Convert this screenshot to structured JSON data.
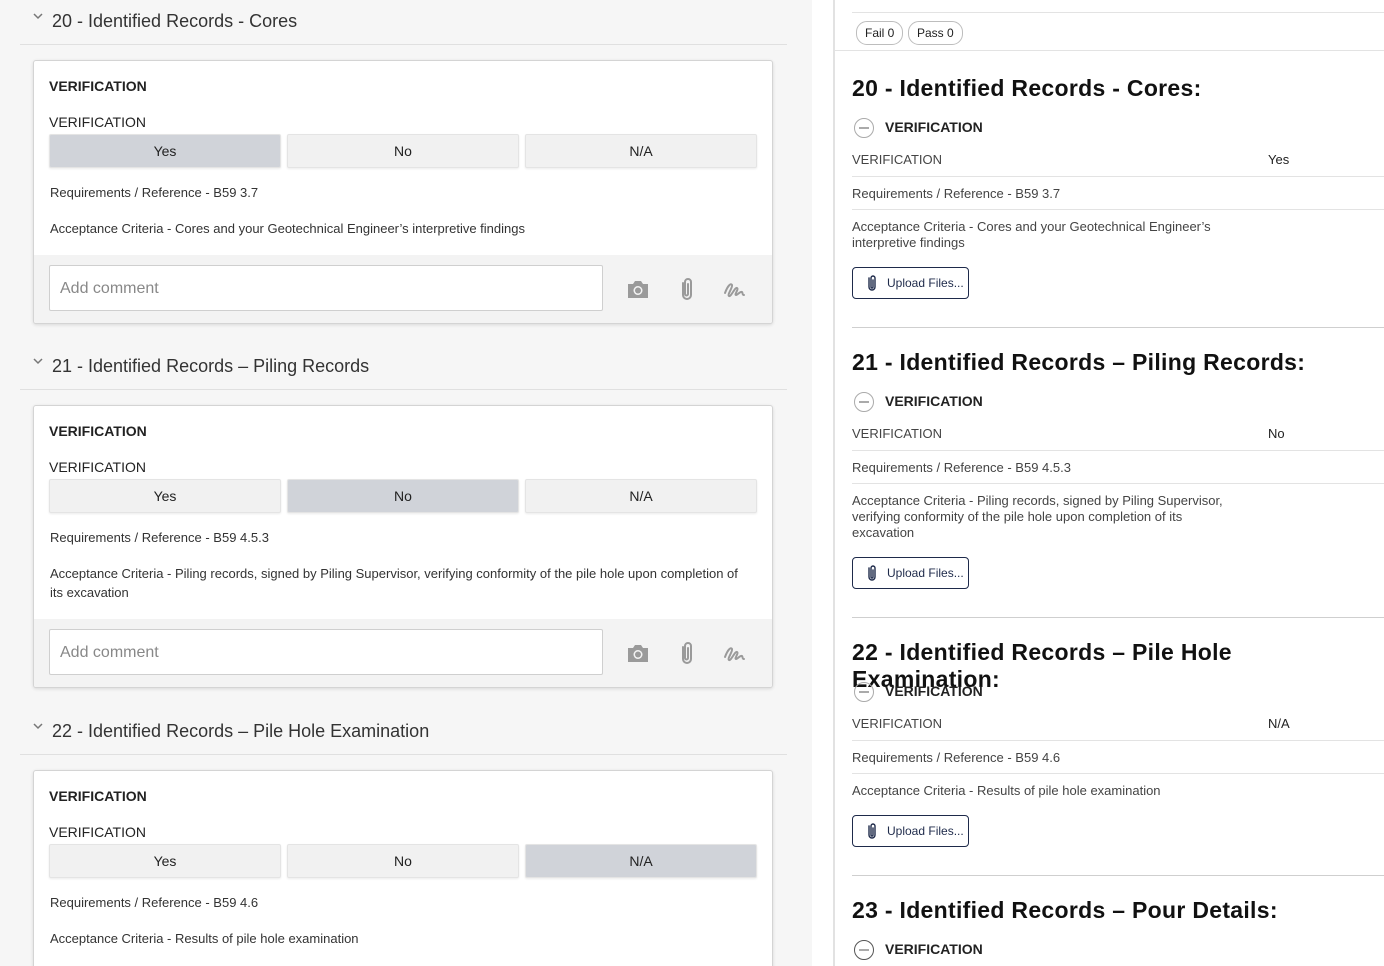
{
  "left": {
    "sections": [
      {
        "title": "20 - Identified Records - Cores",
        "heading": "VERIFICATION",
        "question": "VERIFICATION",
        "options": [
          "Yes",
          "No",
          "N/A"
        ],
        "selected": "Yes",
        "requirements": "Requirements / Reference - B59 3.7",
        "acceptance": "Acceptance Criteria - Cores and your Geotechnical Engineer’s interpretive findings",
        "comment_placeholder": "Add comment"
      },
      {
        "title": "21 - Identified Records – Piling Records",
        "heading": "VERIFICATION",
        "question": "VERIFICATION",
        "options": [
          "Yes",
          "No",
          "N/A"
        ],
        "selected": "No",
        "requirements": "Requirements / Reference - B59 4.5.3",
        "acceptance": "Acceptance Criteria - Piling records, signed by Piling Supervisor, verifying conformity of the pile hole upon completion of its excavation",
        "comment_placeholder": "Add comment"
      },
      {
        "title": "22 - Identified Records – Pile Hole Examination",
        "heading": "VERIFICATION",
        "question": "VERIFICATION",
        "options": [
          "Yes",
          "No",
          "N/A"
        ],
        "selected": "N/A",
        "requirements": "Requirements / Reference - B59 4.6",
        "acceptance": "Acceptance Criteria - Results of pile hole examination"
      }
    ]
  },
  "right": {
    "fail_pill": "Fail 0",
    "pass_pill": "Pass 0",
    "upload_label": "Upload Files...",
    "sections": [
      {
        "title": "20 - Identified Records - Cores:",
        "verification": "VERIFICATION",
        "row_label": "VERIFICATION",
        "row_value": "Yes",
        "requirements": "Requirements / Reference - B59 3.7",
        "acceptance": "Acceptance Criteria - Cores and your Geotechnical Engineer’s interpretive findings"
      },
      {
        "title": "21 - Identified Records – Piling Records:",
        "verification": "VERIFICATION",
        "row_label": "VERIFICATION",
        "row_value": "No",
        "requirements": "Requirements / Reference - B59 4.5.3",
        "acceptance": "Acceptance Criteria - Piling records, signed by Piling Supervisor, verifying conformity of the pile hole upon completion of its excavation"
      },
      {
        "title": "22 - Identified Records – Pile Hole Examination:",
        "verification": "VERIFICATION",
        "row_label": "VERIFICATION",
        "row_value": "N/A",
        "requirements": "Requirements / Reference - B59 4.6",
        "acceptance": "Acceptance Criteria - Results of pile hole examination"
      },
      {
        "title": "23 - Identified Records – Pour Details:",
        "verification": "VERIFICATION"
      }
    ]
  },
  "icons": [
    "chevron-down-icon",
    "camera-icon",
    "paperclip-icon",
    "signature-icon",
    "minus-circle-icon",
    "circle-icon"
  ]
}
